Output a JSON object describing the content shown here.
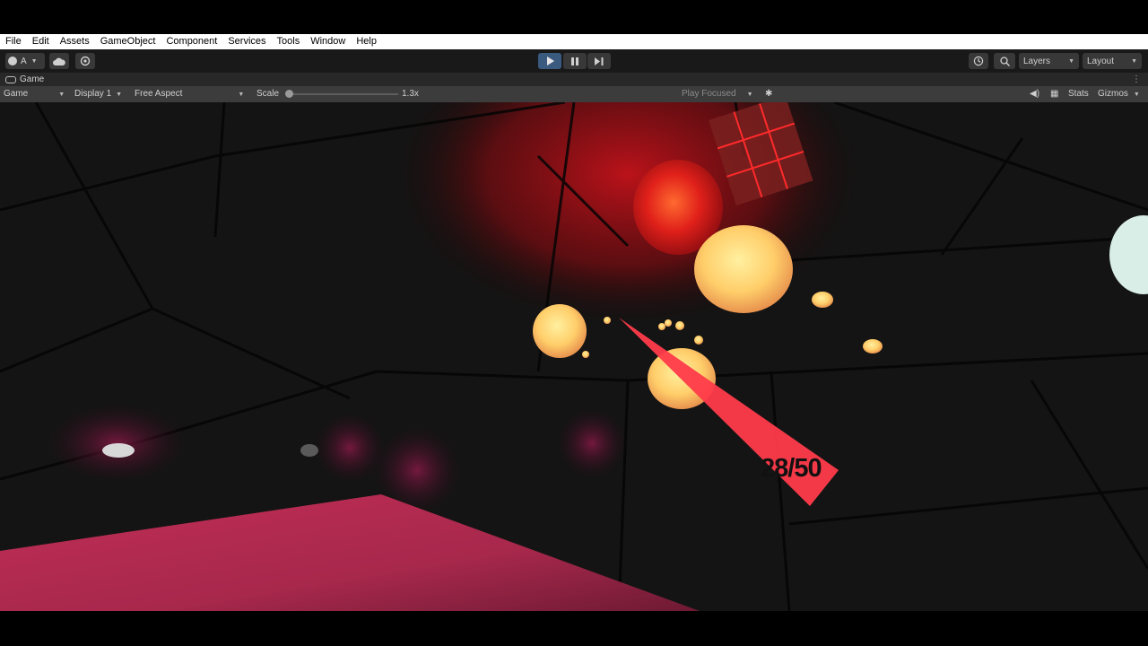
{
  "menubar": {
    "items": [
      "File",
      "Edit",
      "Assets",
      "GameObject",
      "Component",
      "Services",
      "Tools",
      "Window",
      "Help"
    ]
  },
  "toolbar": {
    "account_label": "A",
    "layers_label": "Layers",
    "layout_label": "Layout",
    "icons": {
      "account": "account-icon",
      "cloud": "cloud-icon",
      "collab": "collab-icon",
      "play": "play-icon",
      "pause": "pause-icon",
      "step": "step-icon",
      "history": "history-icon",
      "search": "search-icon"
    },
    "play_active_color": "#3a5a80"
  },
  "tab": {
    "title": "Game"
  },
  "game_bar": {
    "view_mode": "Game",
    "display": "Display 1",
    "aspect": "Free Aspect",
    "scale_label": "Scale",
    "scale_value": "1.3x",
    "play_mode": "Play Focused",
    "stats_label": "Stats",
    "gizmos_label": "Gizmos"
  },
  "game": {
    "hud_counter": "28/50",
    "colors": {
      "glow_red": "#c4121a",
      "orb_warm": "#ffce6a",
      "pointer": "#ff3b4a",
      "floor": "#a8284c"
    }
  }
}
